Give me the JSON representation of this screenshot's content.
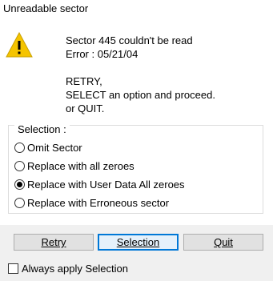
{
  "dialog": {
    "title": "Unreadable sector",
    "icon": "warning-icon",
    "message": {
      "line1": "Sector 445 couldn't be read",
      "line2": "Error : 05/21/04",
      "line3": "RETRY,",
      "line4": "SELECT an option and proceed.",
      "line5": "or QUIT."
    }
  },
  "selection": {
    "label": "Selection :",
    "selected_index": 2,
    "options": [
      {
        "label": "Omit Sector",
        "checked": false
      },
      {
        "label": "Replace with all zeroes",
        "checked": false
      },
      {
        "label": "Replace with User Data All zeroes",
        "checked": true
      },
      {
        "label": "Replace with Erroneous sector",
        "checked": false
      }
    ]
  },
  "buttons": {
    "retry": "Retry",
    "selection": "Selection",
    "quit": "Quit",
    "default": "selection"
  },
  "always_apply": {
    "label": "Always apply Selection",
    "checked": false
  },
  "colors": {
    "warning_yellow": "#f5c400",
    "default_button_border": "#0078d7",
    "button_face": "#e1e1e1",
    "footer_bg": "#f0f0f0"
  }
}
